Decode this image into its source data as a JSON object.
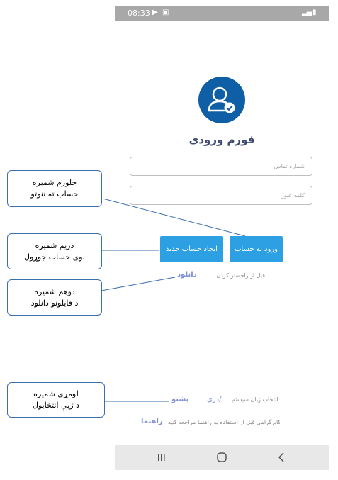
{
  "status_bar": {
    "time": "08:33"
  },
  "form": {
    "title": "فورم ورودی",
    "phone_placeholder": "شماره تماس",
    "password_placeholder": "کلمه عبور",
    "login_button": "ورود به حساب",
    "create_account_button": "ایجاد حساب جدید"
  },
  "download": {
    "prompt": "قبل از راجستر کردن",
    "link": "دانلود"
  },
  "language": {
    "prompt": "انتخاب زبان سیستم",
    "dari": "دری/",
    "pashto": "پشتو"
  },
  "guide": {
    "prompt": "کابرگرامی قبل از استفاده به راهنما مراجعه کنید",
    "link": "راهنما"
  },
  "callouts": [
    {
      "line1": "خلورم شمیره",
      "line2": "حساب ته ننوتو"
    },
    {
      "line1": "دریم شمیره",
      "line2": "نوی حساب جوړول"
    },
    {
      "line1": "دوهم شمیره",
      "line2": "د فایلونو دانلود"
    },
    {
      "line1": "لومړی شمیره",
      "line2": "د ژبې انتخابول"
    }
  ],
  "colors": {
    "primary": "#2d9fe3",
    "avatar": "#0f5fa6",
    "title": "#3e4b73",
    "link": "#7c8fd6",
    "callout_border": "#3a6fb0"
  }
}
